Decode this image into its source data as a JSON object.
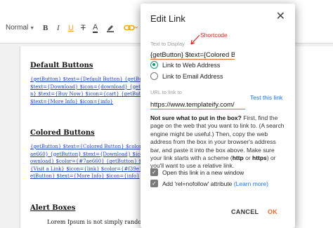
{
  "toolbar": {
    "format_value": "Normal",
    "bold": "B",
    "italic": "I",
    "underline": "U",
    "strike": "T",
    "text_color": "A"
  },
  "document": {
    "sections": [
      {
        "heading": "Default Buttons",
        "code": "{getButton} $text={Default Button} {getButton} $text={Download} $icon={download} {getButton} $text={Buy Now} $icon={cart} {getButton} $text={More Info} $icon={info}"
      },
      {
        "heading": "Colored Buttons",
        "code": "{getButton} $text={Colored Button} $color={#7ae660} {getButton} $text={Download} $icon={download} $color={#7ae660} {getButton} $text={Visit a Link} $icon={link} $color={#f39e12} {getButton} $text={More Info} $icon={info}"
      },
      {
        "heading": "Alert Boxes",
        "body": "Lorem Ipsum is not simply random to"
      }
    ]
  },
  "dialog": {
    "title": "Edit Link",
    "close_glyph": "✕",
    "text_to_display_label": "Text to Display",
    "text_to_display_value": "{getButton} $text={Colored B",
    "annotation": "Shortcode",
    "link_options": [
      {
        "label": "Link to Web Address",
        "selected": true
      },
      {
        "label": "Link to Email Address",
        "selected": false
      }
    ],
    "url_label": "URL to link to",
    "url_value": "https://www.templateify.com/",
    "test_link": "Test this link",
    "help": {
      "lead": "Not sure what to put in the box?",
      "text_1": " First, find the page on the web that you want to link to. (A search engine might be useful.) Then, copy the web address from the box in your browser's address bar, and paste it into the box above. Make sure your link starts with a scheme (",
      "http": "http",
      "or": " or ",
      "https": "https",
      "text_2": ") or you'll want to use a relative link."
    },
    "checkboxes": [
      {
        "label": "Open this link in a new window",
        "checked": true
      },
      {
        "label": "Add 'rel=nofollow' attribute",
        "checked": true,
        "link": "(Learn more)"
      }
    ],
    "cancel_label": "CANCEL",
    "ok_label": "OK"
  },
  "colors": {
    "accent": "#e96b2b",
    "radio_selected": "#129a78",
    "link": "#1a73e8",
    "annotation": "#e02020"
  }
}
